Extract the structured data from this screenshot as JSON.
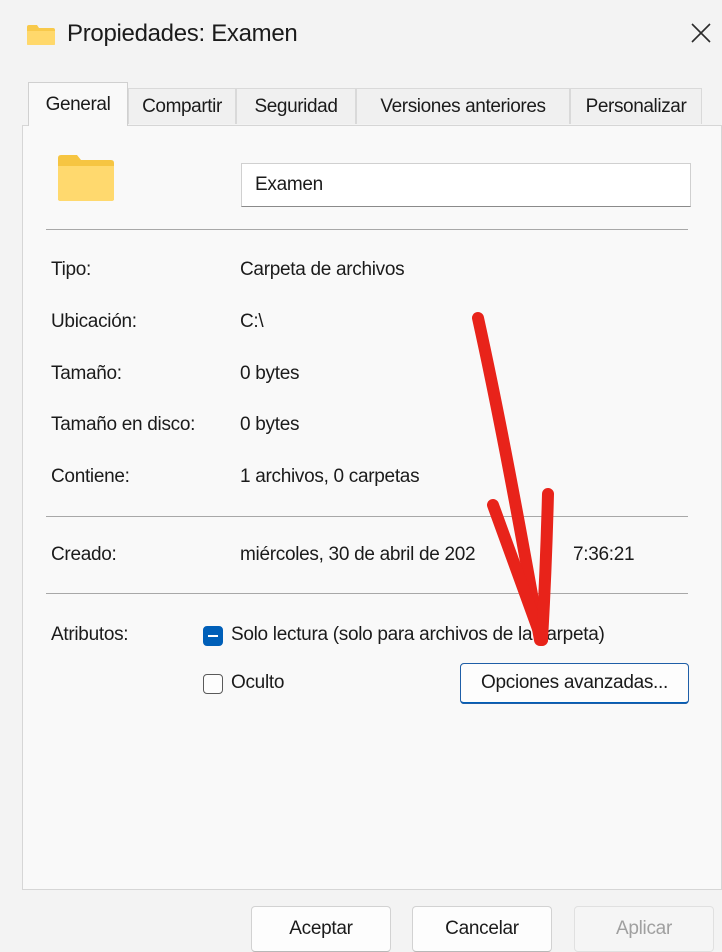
{
  "window": {
    "title": "Propiedades: Examen",
    "title_icon": "folder-icon",
    "close_icon": "close-icon"
  },
  "tabs": [
    {
      "label": "General",
      "active": true
    },
    {
      "label": "Compartir",
      "active": false
    },
    {
      "label": "Seguridad",
      "active": false
    },
    {
      "label": "Versiones anteriores",
      "active": false
    },
    {
      "label": "Personalizar",
      "active": false
    }
  ],
  "general": {
    "folder_icon": "folder-icon",
    "name_value": "Examen",
    "rows": [
      {
        "label": "Tipo:",
        "value": "Carpeta de archivos"
      },
      {
        "label": "Ubicación:",
        "value": "C:\\"
      },
      {
        "label": "Tamaño:",
        "value": "0 bytes"
      },
      {
        "label": "Tamaño en disco:",
        "value": "0 bytes"
      },
      {
        "label": "Contiene:",
        "value": "1 archivos, 0 carpetas"
      }
    ],
    "created_label": "Creado:",
    "created_value": "miércoles, 30 de abril de 202",
    "created_value_tail": "7:36:21",
    "attributes_label": "Atributos:",
    "readonly_label": "Solo lectura (solo para archivos de la carpeta)",
    "readonly_state": "indeterminate",
    "hidden_label": "Oculto",
    "hidden_state": "unchecked",
    "advanced_button": "Opciones avanzadas..."
  },
  "footer": {
    "ok": "Aceptar",
    "cancel": "Cancelar",
    "apply": "Aplicar",
    "apply_enabled": false
  },
  "annotation": {
    "icon": "red-arrow-icon",
    "color": "#e8231a"
  },
  "colors": {
    "accent": "#005fb8",
    "folder": "#ffd75e",
    "background": "#f3f3f3"
  }
}
